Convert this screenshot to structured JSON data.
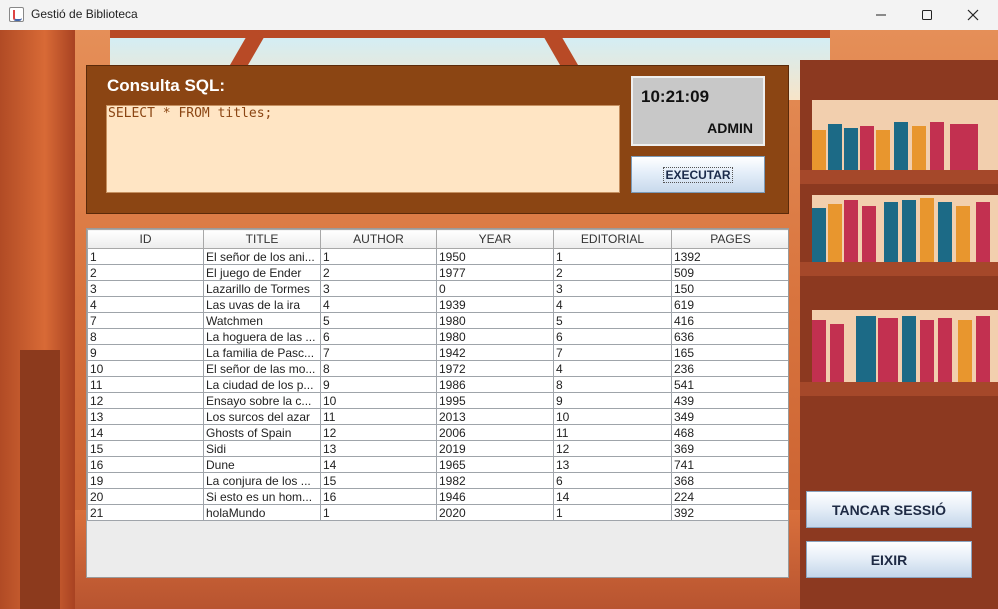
{
  "window": {
    "title": "Gestió de Biblioteca",
    "app_icon": "java-cup-icon",
    "controls": [
      "minimize-icon",
      "maximize-icon",
      "close-icon"
    ]
  },
  "sql_panel": {
    "label": "Consulta SQL:",
    "query": "SELECT * FROM titles;",
    "clock": "10:21:09",
    "user": "ADMIN",
    "execute_label": "EXECUTAR"
  },
  "table": {
    "headers": [
      "ID",
      "TITLE",
      "AUTHOR",
      "YEAR",
      "EDITORIAL",
      "PAGES"
    ],
    "rows": [
      [
        "1",
        "El señor de los ani...",
        "1",
        "1950",
        "1",
        "1392"
      ],
      [
        "2",
        "El juego de Ender",
        "2",
        "1977",
        "2",
        "509"
      ],
      [
        "3",
        "Lazarillo de Tormes",
        "3",
        "0",
        "3",
        "150"
      ],
      [
        "4",
        "Las uvas de la ira",
        "4",
        "1939",
        "4",
        "619"
      ],
      [
        "7",
        "Watchmen",
        "5",
        "1980",
        "5",
        "416"
      ],
      [
        "8",
        "La hoguera de las ...",
        "6",
        "1980",
        "6",
        "636"
      ],
      [
        "9",
        "La familia de Pasc...",
        "7",
        "1942",
        "7",
        "165"
      ],
      [
        "10",
        "El señor de las mo...",
        "8",
        "1972",
        "4",
        "236"
      ],
      [
        "11",
        "La ciudad de los p...",
        "9",
        "1986",
        "8",
        "541"
      ],
      [
        "12",
        "Ensayo sobre la c...",
        "10",
        "1995",
        "9",
        "439"
      ],
      [
        "13",
        "Los surcos del azar",
        "11",
        "2013",
        "10",
        "349"
      ],
      [
        "14",
        "Ghosts of Spain",
        "12",
        "2006",
        "11",
        "468"
      ],
      [
        "15",
        "Sidi",
        "13",
        "2019",
        "12",
        "369"
      ],
      [
        "16",
        "Dune",
        "14",
        "1965",
        "13",
        "741"
      ],
      [
        "19",
        "La conjura de los ...",
        "15",
        "1982",
        "6",
        "368"
      ],
      [
        "20",
        "Si esto es un hom...",
        "16",
        "1946",
        "14",
        "224"
      ],
      [
        "21",
        "holaMundo",
        "1",
        "2020",
        "1",
        "392"
      ]
    ]
  },
  "actions": {
    "logout_label": "TANCAR SESSIÓ",
    "exit_label": "EIXIR"
  },
  "colors": {
    "panel": "#8b4513",
    "sql_box": "#ffe5c4",
    "clock_box": "#c8c8c8"
  }
}
